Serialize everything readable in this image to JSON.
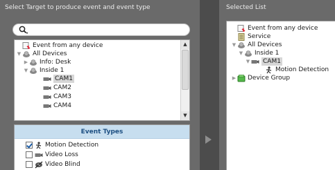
{
  "left_panel": {
    "title": "Select Target to produce event and event type",
    "search": {
      "value": ""
    },
    "tree": [
      {
        "label": "Event from any device",
        "icon": "event-icon",
        "arrow": ""
      },
      {
        "label": "All Devices",
        "icon": "devices-icon",
        "arrow": "▼"
      },
      {
        "label": "Info: Desk",
        "icon": "devices-icon",
        "arrow": "▶"
      },
      {
        "label": "Inside 1",
        "icon": "devices-icon",
        "arrow": "▼"
      },
      {
        "label": "CAM1",
        "icon": "camera-icon",
        "arrow": ""
      },
      {
        "label": "CAM2",
        "icon": "camera-icon",
        "arrow": ""
      },
      {
        "label": "CAM3",
        "icon": "camera-icon",
        "arrow": ""
      },
      {
        "label": "CAM4",
        "icon": "camera-icon",
        "arrow": ""
      }
    ],
    "event_types": {
      "header": "Event Types",
      "items": [
        {
          "label": "Motion Detection",
          "checked": true,
          "icon": "motion-icon"
        },
        {
          "label": "Video Loss",
          "checked": false,
          "icon": "video-loss-icon"
        },
        {
          "label": "Video Blind",
          "checked": false,
          "icon": "video-blind-icon"
        }
      ]
    }
  },
  "move_button": {
    "icon": "arrow-right-icon"
  },
  "right_panel": {
    "title": "Selected List",
    "tree": [
      {
        "label": "Event from any device",
        "icon": "event-icon",
        "arrow": ""
      },
      {
        "label": "Service",
        "icon": "service-icon",
        "arrow": ""
      },
      {
        "label": "All Devices",
        "icon": "devices-icon",
        "arrow": "▼"
      },
      {
        "label": "Inside 1",
        "icon": "devices-icon",
        "arrow": "▼"
      },
      {
        "label": "CAM1",
        "icon": "camera-icon",
        "arrow": "▼"
      },
      {
        "label": "Motion Detection",
        "icon": "motion-icon",
        "arrow": ""
      },
      {
        "label": "Device Group",
        "icon": "device-group-icon",
        "arrow": "▶"
      }
    ]
  },
  "colors": {
    "panel_bg": "#6a6a6a",
    "header_bg": "#c7deef",
    "header_text": "#1d4f82",
    "selection_bg": "#d6d6d6"
  }
}
